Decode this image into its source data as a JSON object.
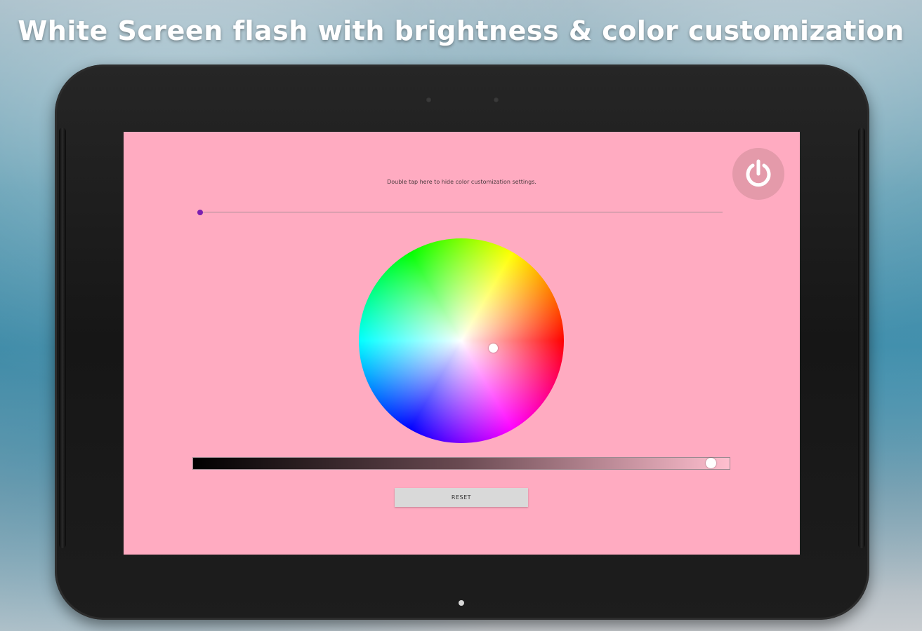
{
  "headline": "White Screen flash with brightness & color customization",
  "screen": {
    "background_color": "#ffabc1",
    "hint_text": "Double tap here to hide color customization settings.",
    "power_icon": "power-icon",
    "top_slider": {
      "value": 0.0,
      "thumb_color": "#7a1fb0"
    },
    "color_wheel": {
      "selected_color": "#ffabc1"
    },
    "brightness_slider": {
      "value": 0.96
    },
    "reset_label": "RESET"
  }
}
